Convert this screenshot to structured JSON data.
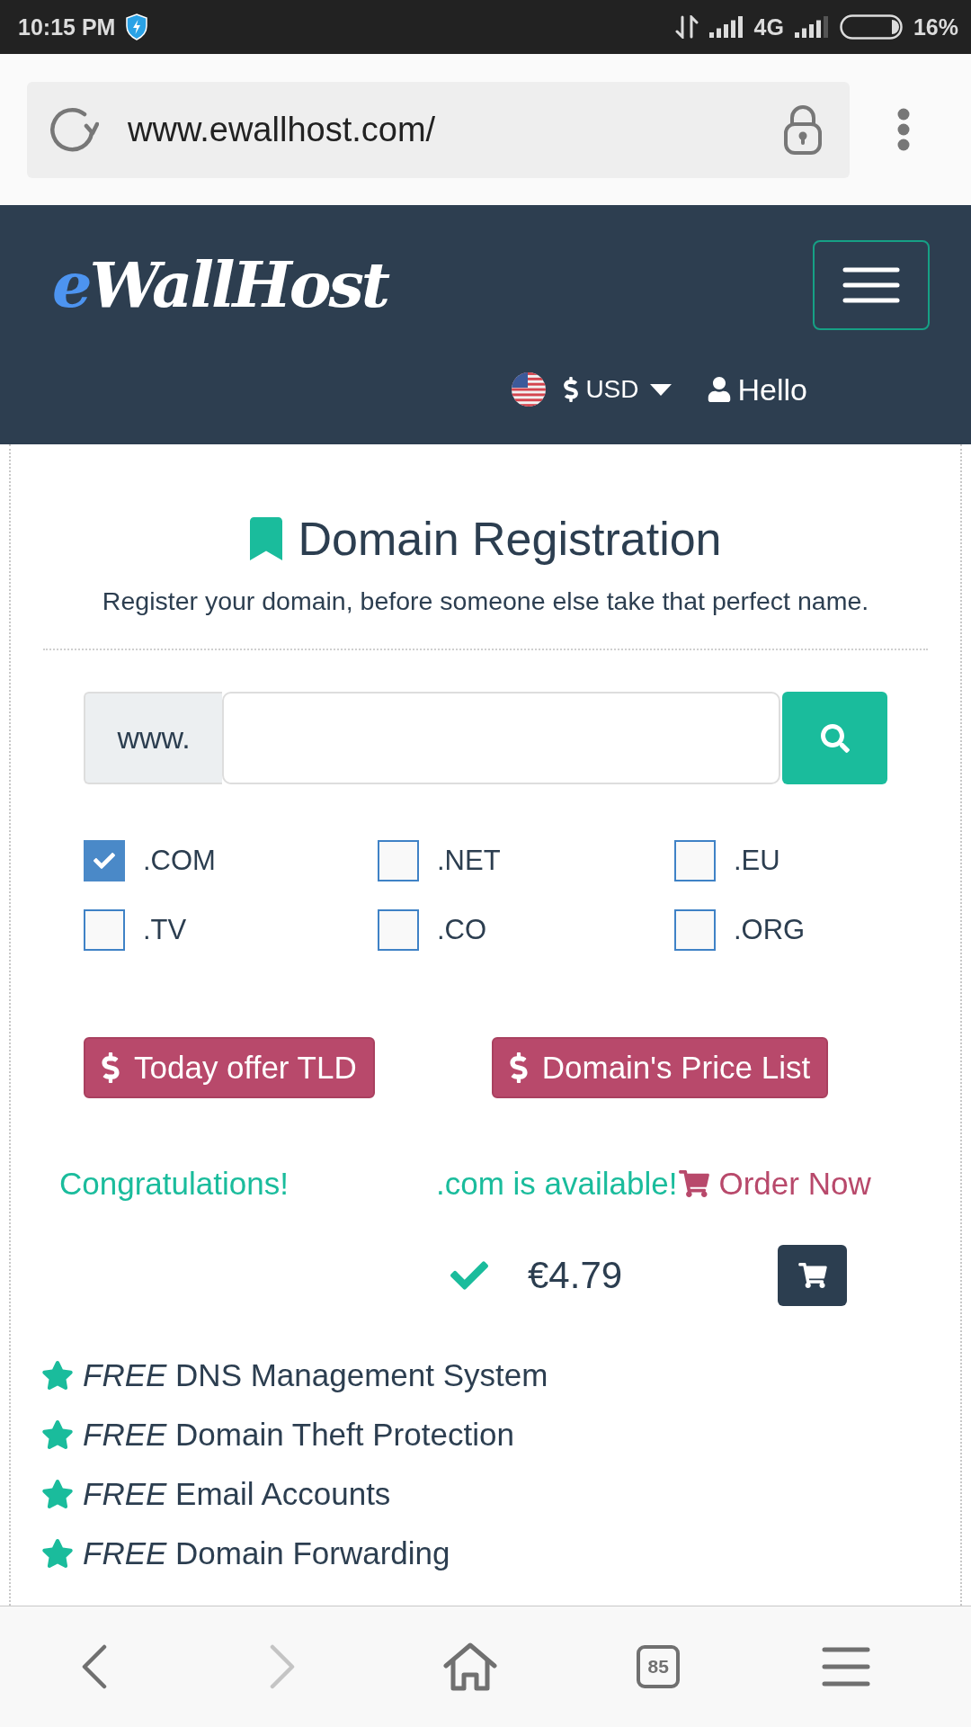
{
  "status_bar": {
    "time": "10:15 PM",
    "network": "4G",
    "battery": "16%"
  },
  "browser": {
    "url": "www.ewallhost.com/"
  },
  "header": {
    "logo": {
      "accent": "e",
      "name": "WallHost"
    },
    "currency": "USD",
    "account": "Hello"
  },
  "domain_search": {
    "title": "Domain Registration",
    "subtitle": "Register your domain, before someone else take that perfect name.",
    "prefix": "www."
  },
  "extensions": [
    {
      "label": ".COM",
      "checked": true
    },
    {
      "label": ".NET",
      "checked": false
    },
    {
      "label": ".EU",
      "checked": false
    },
    {
      "label": ".TV",
      "checked": false
    },
    {
      "label": ".CO",
      "checked": false
    },
    {
      "label": ".ORG",
      "checked": false
    }
  ],
  "buttons": [
    "Today offer TLD",
    "Domain's Price List"
  ],
  "result": {
    "message": "Congratulations!",
    "availability": ".com is available!",
    "order_link": "Order Now",
    "price": "€4.79"
  },
  "features": [
    "*FREE* DNS Management System",
    "*FREE* Domain Theft Protection",
    "*FREE* Email Accounts",
    "*FREE* Domain Forwarding"
  ],
  "bottom_nav": [
    {
      "kind": "back",
      "disabled": false
    },
    {
      "kind": "forward",
      "disabled": true
    },
    {
      "kind": "home",
      "disabled": false
    },
    {
      "kind": "tabs",
      "count": "85",
      "disabled": false
    },
    {
      "kind": "menu",
      "disabled": false
    }
  ]
}
